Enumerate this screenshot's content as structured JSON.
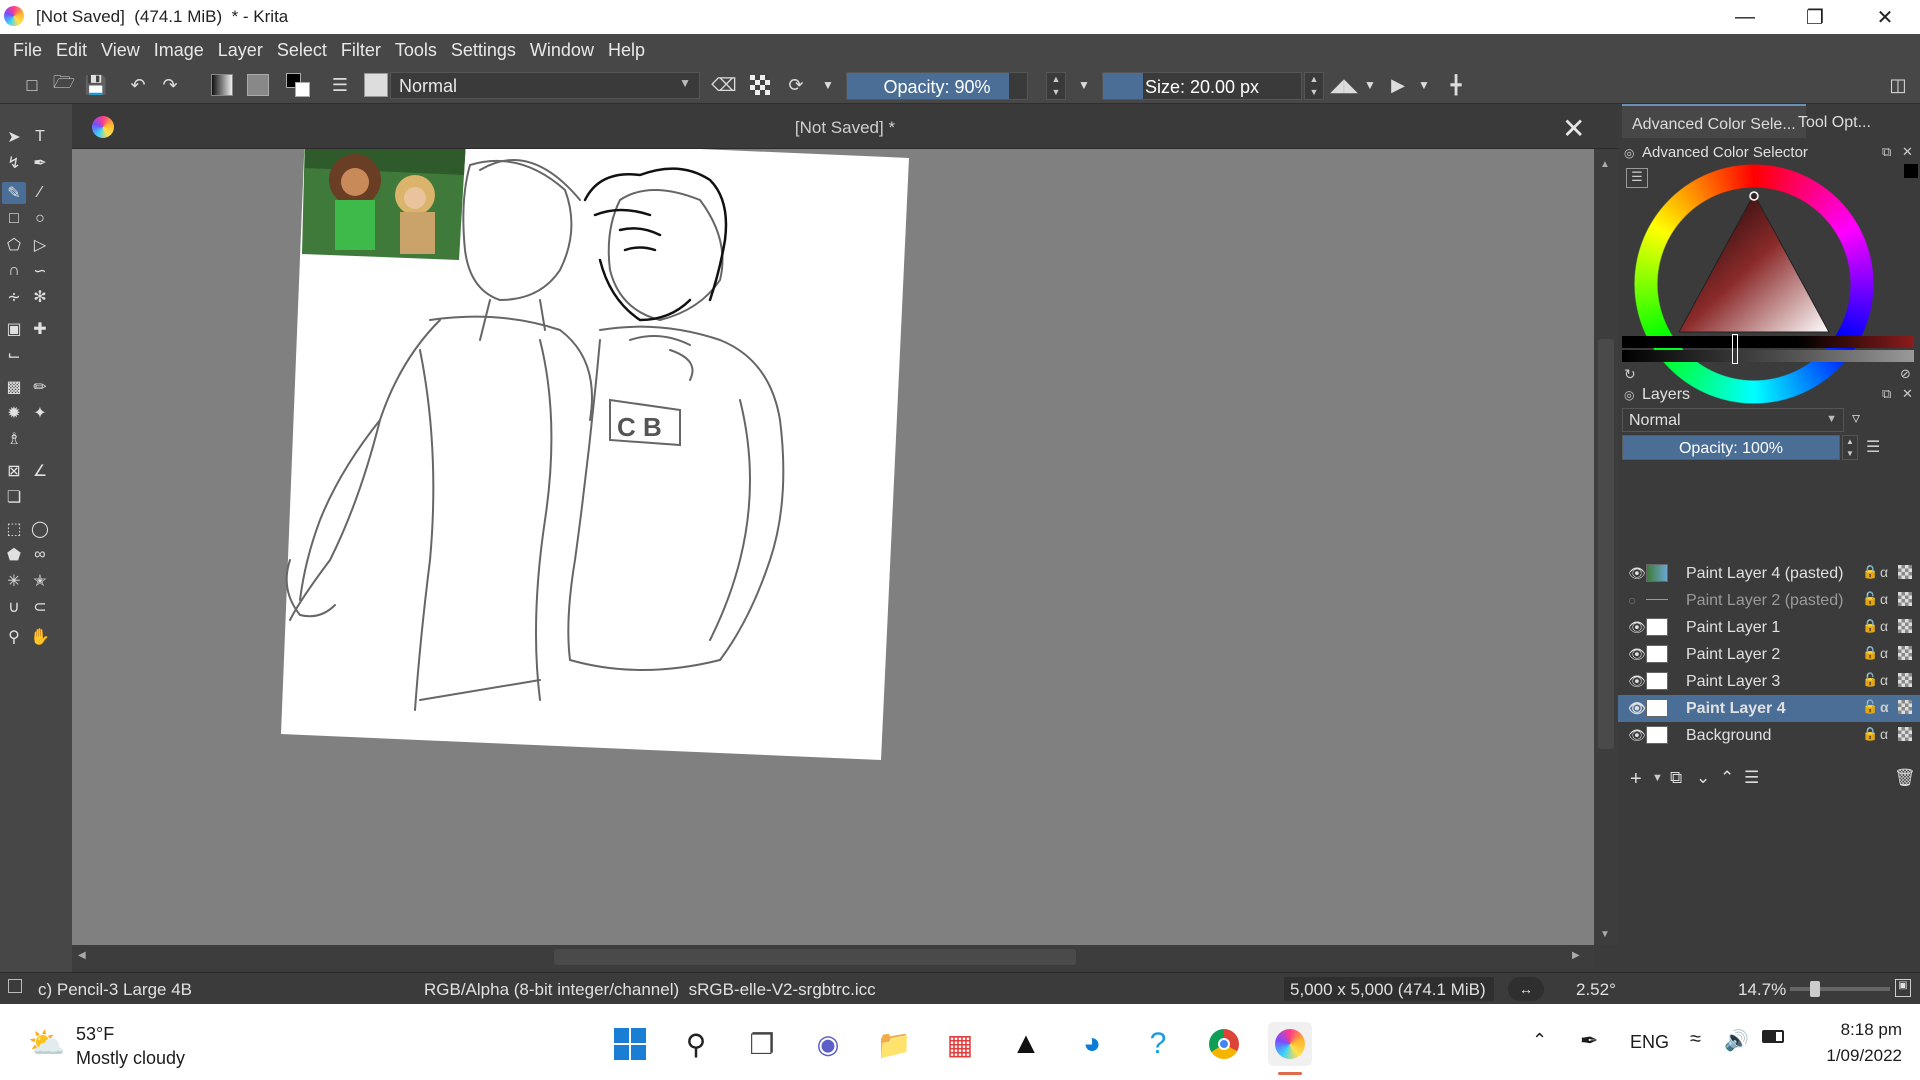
{
  "window": {
    "title": "[Not Saved]  (474.1 MiB)  * - Krita"
  },
  "menubar": {
    "items": [
      "File",
      "Edit",
      "View",
      "Image",
      "Layer",
      "Select",
      "Filter",
      "Tools",
      "Settings",
      "Window",
      "Help"
    ]
  },
  "toolbar": {
    "blend_mode": "Normal",
    "opacity_label": "Opacity: 90%",
    "opacity_value": 0.9,
    "size_label": "Size: 20.00 px"
  },
  "document": {
    "tab_title": "[Not Saved]  *"
  },
  "right_panel": {
    "tab_color": "Advanced Color Sele...",
    "tab_tool": "Tool Opt...",
    "color_selector_title": "Advanced Color Selector",
    "layers_title": "Layers",
    "layers_blend": "Normal",
    "layers_opacity_label": "Opacity:  100%",
    "layers": [
      {
        "name": "Paint Layer 4 (pasted)",
        "visible": true,
        "selected": false
      },
      {
        "name": "Paint Layer 2 (pasted)",
        "visible": false,
        "selected": false
      },
      {
        "name": "Paint Layer 1",
        "visible": true,
        "selected": false
      },
      {
        "name": "Paint Layer 2",
        "visible": true,
        "selected": false
      },
      {
        "name": "Paint Layer 3",
        "visible": true,
        "selected": false
      },
      {
        "name": "Paint Layer 4",
        "visible": true,
        "selected": true
      },
      {
        "name": "Background",
        "visible": true,
        "selected": false
      }
    ]
  },
  "statusbar": {
    "brush": "c) Pencil-3 Large 4B",
    "color_info": "RGB/Alpha (8-bit integer/channel)  sRGB-elle-V2-srgbtrc.icc",
    "dimensions": "5,000 x 5,000 (474.1 MiB)",
    "rotation": "2.52°",
    "zoom": "14.7%"
  },
  "taskbar": {
    "temperature": "53°F",
    "weather": "Mostly cloudy",
    "language": "ENG",
    "time": "8:18 pm",
    "date": "1/09/2022"
  },
  "colors": {
    "accent": "#4a6e95",
    "canvas_bg": "#808080",
    "panel_bg": "#3b3b3b"
  }
}
